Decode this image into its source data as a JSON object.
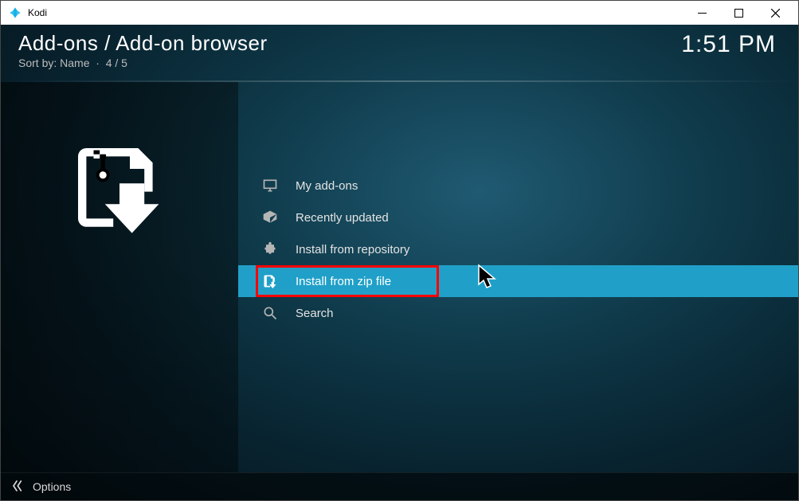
{
  "window": {
    "title": "Kodi"
  },
  "header": {
    "breadcrumb": "Add-ons / Add-on browser",
    "sort_label": "Sort by: Name",
    "counter": "4 / 5",
    "clock": "1:51 PM"
  },
  "list": {
    "items": [
      {
        "label": "My add-ons",
        "icon": "monitor-icon"
      },
      {
        "label": "Recently updated",
        "icon": "box-open-icon"
      },
      {
        "label": "Install from repository",
        "icon": "puzzle-icon"
      },
      {
        "label": "Install from zip file",
        "icon": "zip-download-icon"
      },
      {
        "label": "Search",
        "icon": "search-icon"
      }
    ],
    "selected_index": 3
  },
  "footer": {
    "options_label": "Options"
  }
}
